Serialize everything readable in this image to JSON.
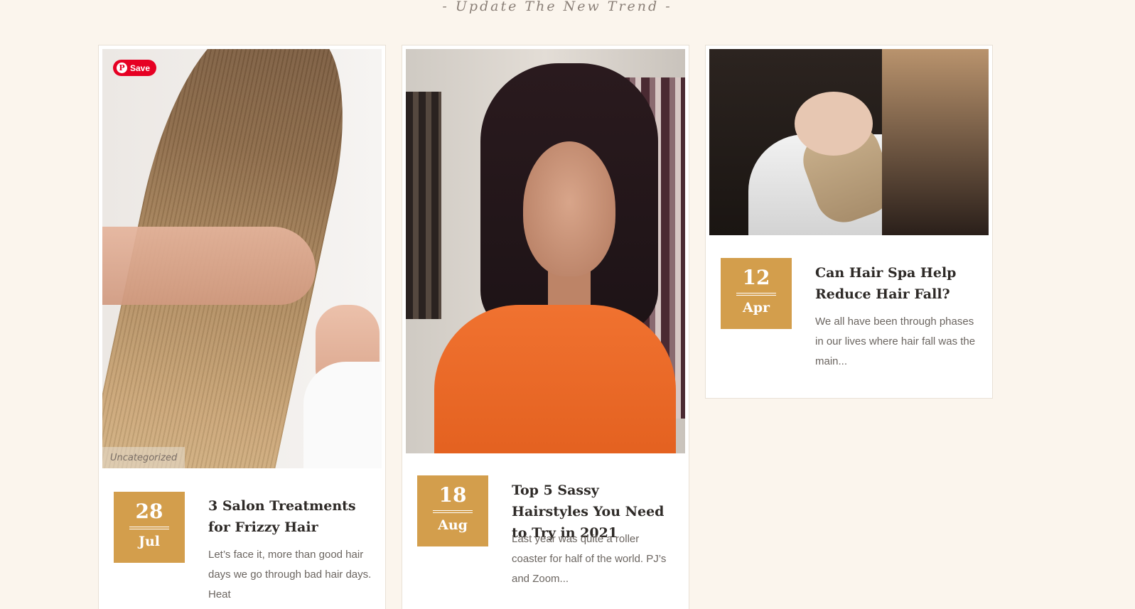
{
  "section": {
    "subtitle": "- Update The New Trend -"
  },
  "pinterest": {
    "save_label": "Save",
    "icon": "pinterest-icon",
    "color": "#e60023"
  },
  "accent_color": "#d39e4c",
  "posts": [
    {
      "category": "Uncategorized",
      "day": "28",
      "month": "Jul",
      "title": "3 Salon Treatments for Frizzy Hair",
      "excerpt": "Let’s face it, more than good hair days we go through bad hair days. Heat"
    },
    {
      "category": "",
      "day": "18",
      "month": "Aug",
      "title": "Top 5 Sassy Hairstyles You Need to Try in 2021",
      "excerpt": "Last year was quite a roller coaster for half of the world. PJ’s and Zoom..."
    },
    {
      "category": "",
      "day": "12",
      "month": "Apr",
      "title": "Can Hair Spa Help Reduce Hair Fall?",
      "excerpt": "We all have been through phases in our lives where hair fall was the main..."
    }
  ]
}
